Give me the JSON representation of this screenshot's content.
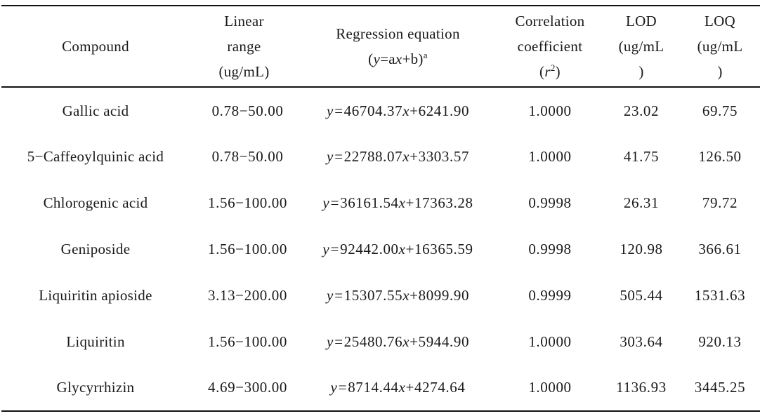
{
  "table": {
    "headers": {
      "compound": "Compound",
      "linear_range": [
        "Linear",
        "range",
        "(ug/mL)"
      ],
      "regression": {
        "line1": "Regression equation",
        "open_paren": "(",
        "var_y": "y",
        "eq_mid": "=a",
        "var_x": "x",
        "eq_end": "+b)",
        "footnote_mark": "a"
      },
      "correlation": {
        "line1": "Correlation",
        "line2": "coefficient",
        "open_paren": "(",
        "var_r": "r",
        "exponent": "2",
        "close_paren": ")"
      },
      "lod": [
        "LOD",
        "(ug/mL",
        ")"
      ],
      "loq": [
        "LOQ",
        "(ug/mL",
        ")"
      ]
    },
    "rows": [
      {
        "compound": "Gallic acid",
        "linear_range": "0.78−50.00",
        "eq_slope": "46704.37",
        "eq_intercept": "6241.90",
        "eq_y": "y=",
        "eq_x": "x",
        "eq_plus": "+",
        "correlation": "1.0000",
        "lod": "23.02",
        "loq": "69.75"
      },
      {
        "compound": "5−Caffeoylquinic acid",
        "linear_range": "0.78−50.00",
        "eq_slope": "22788.07",
        "eq_intercept": "3303.57",
        "eq_y": "y=",
        "eq_x": "x",
        "eq_plus": "+",
        "correlation": "1.0000",
        "lod": "41.75",
        "loq": "126.50"
      },
      {
        "compound": "Chlorogenic acid",
        "linear_range": "1.56−100.00",
        "eq_slope": "36161.54",
        "eq_intercept": "17363.28",
        "eq_y": "y=",
        "eq_x": "x",
        "eq_plus": "+",
        "correlation": "0.9998",
        "lod": "26.31",
        "loq": "79.72"
      },
      {
        "compound": "Geniposide",
        "linear_range": "1.56−100.00",
        "eq_slope": "92442.00",
        "eq_intercept": "16365.59",
        "eq_y": "y=",
        "eq_x": "x",
        "eq_plus": "+",
        "correlation": "0.9998",
        "lod": "120.98",
        "loq": "366.61"
      },
      {
        "compound": "Liquiritin apioside",
        "linear_range": "3.13−200.00",
        "eq_slope": "15307.55",
        "eq_intercept": "8099.90",
        "eq_y": "y=",
        "eq_x": "x",
        "eq_plus": "+",
        "correlation": "0.9999",
        "lod": "505.44",
        "loq": "1531.63"
      },
      {
        "compound": "Liquiritin",
        "linear_range": "1.56−100.00",
        "eq_slope": "25480.76",
        "eq_intercept": "5944.90",
        "eq_y": "y=",
        "eq_x": "x",
        "eq_plus": "+",
        "correlation": "1.0000",
        "lod": "303.64",
        "loq": "920.13"
      },
      {
        "compound": "Glycyrrhizin",
        "linear_range": "4.69−300.00",
        "eq_slope": "8714.44",
        "eq_intercept": "4274.64",
        "eq_y": "y=",
        "eq_x": "x",
        "eq_plus": "+",
        "correlation": "1.0000",
        "lod": "1136.93",
        "loq": "3445.25"
      }
    ]
  }
}
